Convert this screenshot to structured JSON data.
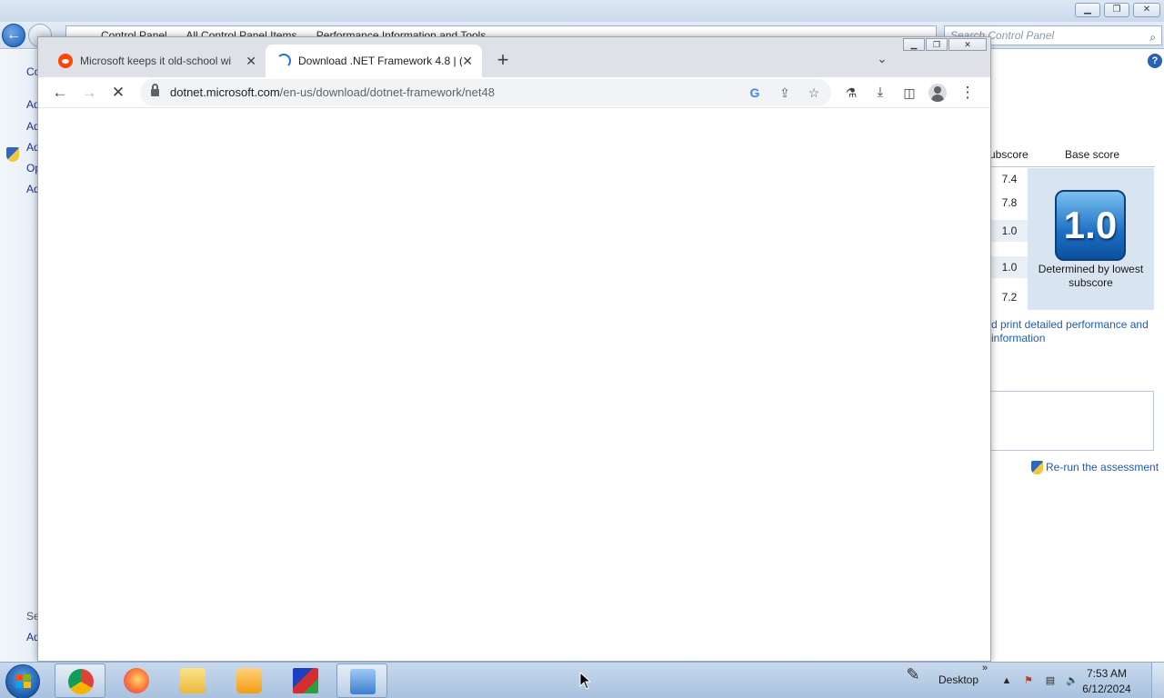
{
  "control_panel": {
    "breadcrumbs": [
      "Control Panel",
      "All Control Panel Items",
      "Performance Information and Tools"
    ],
    "search_placeholder": "Search Control Panel",
    "left_items": [
      "Co",
      "Ad",
      "Ad",
      "Ad",
      "Op",
      "Ad",
      "Se",
      "Ad"
    ],
    "table_header_subscore": "ubscore",
    "table_header_basescore": "Base score",
    "subscores": [
      "7.4",
      "7.8",
      "1.0",
      "1.0",
      "7.2"
    ],
    "base_score": "1.0",
    "determined_text": "Determined by lowest subscore",
    "print_link": "d print detailed performance and information",
    "rerun_link": "Re-run the assessment"
  },
  "chrome": {
    "tabs": [
      {
        "title": "Microsoft keeps it old-school wi",
        "active": false
      },
      {
        "title": "Download .NET Framework 4.8 | (",
        "active": true
      }
    ],
    "tab_close_glyph": "✕",
    "new_tab_glyph": "+",
    "url_host": "dotnet.microsoft.com",
    "url_path": "/en-us/download/dotnet-framework/net48",
    "loading": true
  },
  "taskbar": {
    "apps": [
      {
        "name": "Chrome",
        "color": "#1a73e8",
        "active": true
      },
      {
        "name": "Firefox",
        "color": "#ff7139",
        "active": false
      },
      {
        "name": "File Explorer",
        "color": "#f2c94c",
        "active": false
      },
      {
        "name": "Media Player",
        "color": "#f39c12",
        "active": false
      },
      {
        "name": "App",
        "color": "#d32f2f",
        "active": false
      },
      {
        "name": "Control Panel",
        "color": "#4a90d9",
        "active": true
      }
    ],
    "desktop_label": "Desktop",
    "time": "7:53 AM",
    "date": "6/12/2024"
  }
}
